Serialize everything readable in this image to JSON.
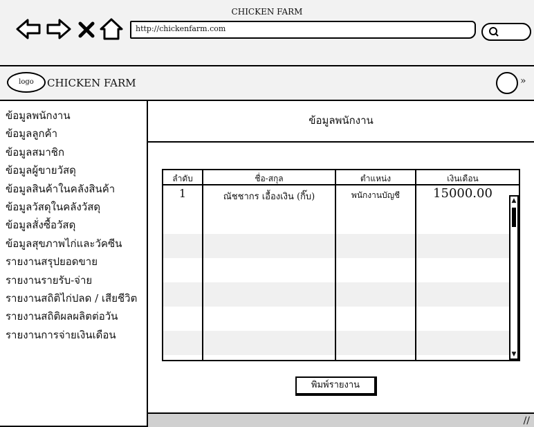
{
  "browser": {
    "window_title": "CHICKEN FARM",
    "url": "http://chickenfarm.com",
    "back_icon": "arrow-left-icon",
    "forward_icon": "arrow-right-icon",
    "stop_icon": "close-icon",
    "home_icon": "home-icon",
    "search_icon": "search-icon"
  },
  "app": {
    "logo_text": "logo",
    "name": "CHICKEN FARM",
    "avatar_icon": "user-avatar-icon",
    "menu_icon": "chevron-down-icon"
  },
  "sidebar": {
    "items": [
      {
        "label": "ข้อมูลพนักงาน"
      },
      {
        "label": "ข้อมูลลูกค้า"
      },
      {
        "label": "ข้อมูลสมาชิก"
      },
      {
        "label": "ข้อมูลผู้ขายวัสดุ"
      },
      {
        "label": "ข้อมูลสินค้าในคลังสินค้า"
      },
      {
        "label": "ข้อมูลวัสดุในคลังวัสดุ"
      },
      {
        "label": "ข้อมูลสั่งซื้อวัสดุ"
      },
      {
        "label": "ข้อมูลสุขภาพไก่และวัคซีน"
      },
      {
        "label": "รายงานสรุปยอดขาย"
      },
      {
        "label": "รายงานรายรับ-จ่าย"
      },
      {
        "label": "รายงานสถิติไก่ปลด / เสียชีวิต"
      },
      {
        "label": "รายงานสถิติผลผลิตต่อวัน"
      },
      {
        "label": "รายงานการจ่ายเงินเดือน"
      }
    ]
  },
  "main": {
    "title": "ข้อมูลพนักงาน",
    "table": {
      "headers": [
        "ลำดับ",
        "ชื่อ-สกุล",
        "ตำแหน่ง",
        "เงินเดือน"
      ],
      "rows": [
        [
          "1",
          "ณัชชากร เอื้องเงิน (กิ๊บ)",
          "พนักงานบัญชี",
          "15000.00"
        ]
      ]
    },
    "print_button": "พิมพ์รายงาน"
  },
  "colors": {
    "chrome": "#f2f2f2",
    "row_alt": "#f0f0f0",
    "statusbar": "#d0d0d0"
  }
}
